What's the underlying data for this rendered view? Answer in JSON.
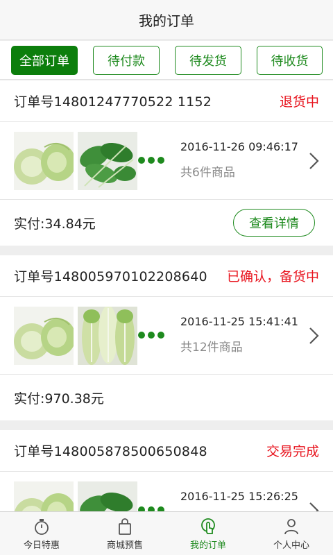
{
  "header": {
    "title": "我的订单"
  },
  "filters": [
    {
      "label": "全部订单",
      "active": true
    },
    {
      "label": "待付款",
      "active": false
    },
    {
      "label": "待发货",
      "active": false
    },
    {
      "label": "待收货",
      "active": false
    }
  ],
  "orders": [
    {
      "order_no": "订单号14801247770522 1152",
      "status": "退货中",
      "date": "2016-11-26 09:46:17",
      "count": "共6件商品",
      "paid": "实付:34.84元",
      "detail_label": "查看详情"
    },
    {
      "order_no": "订单号148005970102208640",
      "status": "已确认，备货中",
      "date": "2016-11-25 15:41:41",
      "count": "共12件商品",
      "paid": "实付:970.38元"
    },
    {
      "order_no": "订单号148005878500650848",
      "status": "交易完成",
      "date": "2016-11-25 15:26:25"
    }
  ],
  "tabs": [
    {
      "label": "今日特惠",
      "icon": "stopwatch-icon"
    },
    {
      "label": "商城预售",
      "icon": "shopping-bag-icon"
    },
    {
      "label": "我的订单",
      "icon": "order-hand-icon"
    },
    {
      "label": "个人中心",
      "icon": "user-icon"
    }
  ],
  "colors": {
    "accent": "#1e8a1e",
    "status": "#e8141e"
  }
}
